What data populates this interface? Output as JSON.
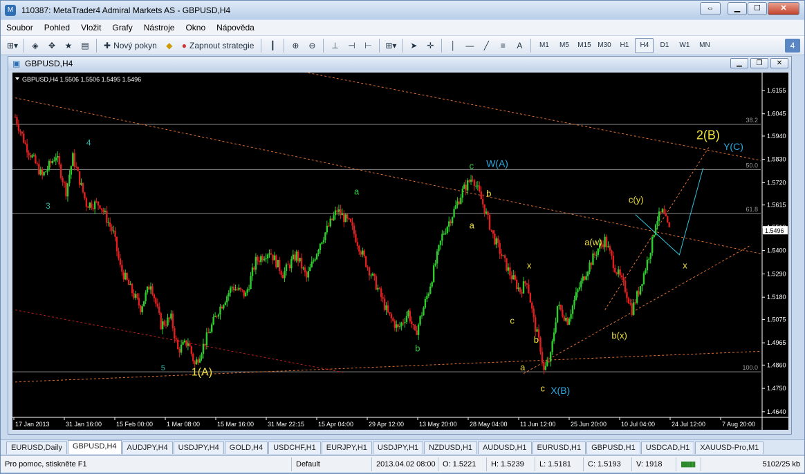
{
  "window": {
    "title": "110387: MetaTrader4 Admiral Markets AS - GBPUSD,H4"
  },
  "menu": [
    "Soubor",
    "Pohled",
    "Vložit",
    "Grafy",
    "Nástroje",
    "Okno",
    "Nápověda"
  ],
  "toolbar": {
    "new_order_label": "Nový pokyn",
    "expert_label": "Zapnout strategie",
    "text_tool_label": "A",
    "timeframes": [
      "M1",
      "M5",
      "M15",
      "M30",
      "H1",
      "H4",
      "D1",
      "W1",
      "MN"
    ],
    "active_timeframe": "H4",
    "badge": "4"
  },
  "chart_window": {
    "title": "GBPUSD,H4"
  },
  "chart_data": {
    "type": "candlestick",
    "symbol_info": "GBPUSD,H4  1.5506 1.5506 1.5495 1.5496",
    "ylim": [
      1.462,
      1.622
    ],
    "y_ticks": [
      "1.6155",
      "1.6045",
      "1.5940",
      "1.5830",
      "1.5720",
      "1.5615",
      "1.5510",
      "1.5400",
      "1.5290",
      "1.5180",
      "1.5075",
      "1.4965",
      "1.4860",
      "1.4750",
      "1.4640"
    ],
    "x_labels": [
      "17 Jan 2013",
      "31 Jan 16:00",
      "15 Feb 00:00",
      "1 Mar 08:00",
      "15 Mar 16:00",
      "31 Mar 22:15",
      "15 Apr 04:00",
      "29 Apr 12:00",
      "13 May 20:00",
      "28 May 04:00",
      "11 Jun 12:00",
      "25 Jun 20:00",
      "10 Jul 04:00",
      "24 Jul 12:00",
      "7 Aug 20:00"
    ],
    "current_price": "1.5496",
    "fib_levels": [
      {
        "label": "38.2",
        "price": 1.5995
      },
      {
        "label": "50.0",
        "price": 1.5782
      },
      {
        "label": "61.8",
        "price": 1.5575
      },
      {
        "label": "100.0",
        "price": 1.4828
      }
    ],
    "price_path": [
      [
        0,
        1.603
      ],
      [
        3,
        1.59
      ],
      [
        8,
        1.575
      ],
      [
        12,
        1.585
      ],
      [
        15,
        1.568
      ],
      [
        17,
        1.584
      ],
      [
        21,
        1.562
      ],
      [
        25,
        1.562
      ],
      [
        29,
        1.548
      ],
      [
        31,
        1.532
      ],
      [
        34,
        1.522
      ],
      [
        37,
        1.513
      ],
      [
        40,
        1.525
      ],
      [
        43,
        1.505
      ],
      [
        46,
        1.508
      ],
      [
        48,
        1.493
      ],
      [
        51,
        1.497
      ],
      [
        53,
        1.486
      ],
      [
        56,
        1.497
      ],
      [
        60,
        1.512
      ],
      [
        64,
        1.523
      ],
      [
        68,
        1.519
      ],
      [
        71,
        1.535
      ],
      [
        75,
        1.54
      ],
      [
        79,
        1.529
      ],
      [
        83,
        1.538
      ],
      [
        86,
        1.527
      ],
      [
        90,
        1.544
      ],
      [
        95,
        1.559
      ],
      [
        99,
        1.552
      ],
      [
        103,
        1.536
      ],
      [
        107,
        1.522
      ],
      [
        110,
        1.51
      ],
      [
        113,
        1.503
      ],
      [
        116,
        1.511
      ],
      [
        118,
        1.5
      ],
      [
        122,
        1.521
      ],
      [
        126,
        1.547
      ],
      [
        129,
        1.557
      ],
      [
        132,
        1.568
      ],
      [
        135,
        1.575
      ],
      [
        138,
        1.562
      ],
      [
        141,
        1.547
      ],
      [
        144,
        1.536
      ],
      [
        146,
        1.529
      ],
      [
        149,
        1.521
      ],
      [
        151,
        1.526
      ],
      [
        153,
        1.507
      ],
      [
        155,
        1.494
      ],
      [
        156,
        1.483
      ],
      [
        158,
        1.49
      ],
      [
        160,
        1.514
      ],
      [
        163,
        1.507
      ],
      [
        166,
        1.521
      ],
      [
        169,
        1.532
      ],
      [
        172,
        1.541
      ],
      [
        174,
        1.545
      ],
      [
        177,
        1.532
      ],
      [
        180,
        1.522
      ],
      [
        182,
        1.512
      ],
      [
        184,
        1.521
      ],
      [
        186,
        1.532
      ],
      [
        188,
        1.544
      ],
      [
        189,
        1.554
      ],
      [
        191,
        1.558
      ],
      [
        193,
        1.5496
      ]
    ],
    "x_max": 220,
    "wave_labels": [
      {
        "text": "4",
        "t": 21,
        "p": 1.5895,
        "color": "#2bb5a5",
        "size": 12
      },
      {
        "text": "3",
        "t": 9,
        "p": 1.5598,
        "color": "#2bb5a5",
        "size": 12
      },
      {
        "text": "5",
        "t": 43,
        "p": 1.4835,
        "color": "#2bb5a5",
        "size": 11
      },
      {
        "text": "1(A)",
        "t": 52,
        "p": 1.481,
        "color": "#f0e040",
        "size": 16
      },
      {
        "text": "a",
        "t": 100,
        "p": 1.5665,
        "color": "#2ecc40",
        "size": 13
      },
      {
        "text": "b",
        "t": 118,
        "p": 1.4925,
        "color": "#2ecc40",
        "size": 13
      },
      {
        "text": "c",
        "t": 134,
        "p": 1.5785,
        "color": "#2ecc40",
        "size": 13
      },
      {
        "text": "W(A)",
        "t": 139,
        "p": 1.5795,
        "color": "#2aa9e0",
        "size": 14
      },
      {
        "text": "b",
        "t": 139,
        "p": 1.5655,
        "color": "#f0e040",
        "size": 13
      },
      {
        "text": "a",
        "t": 134,
        "p": 1.5505,
        "color": "#f0e040",
        "size": 13
      },
      {
        "text": "x",
        "t": 151,
        "p": 1.5315,
        "color": "#f0e040",
        "size": 13
      },
      {
        "text": "c",
        "t": 146,
        "p": 1.5055,
        "color": "#f0e040",
        "size": 13
      },
      {
        "text": "b",
        "t": 153,
        "p": 1.4965,
        "color": "#f0e040",
        "size": 13
      },
      {
        "text": "a",
        "t": 149,
        "p": 1.4835,
        "color": "#f0e040",
        "size": 13
      },
      {
        "text": "c",
        "t": 155,
        "p": 1.4735,
        "color": "#f0e040",
        "size": 13
      },
      {
        "text": "X(B)",
        "t": 158,
        "p": 1.4725,
        "color": "#2aa9e0",
        "size": 14
      },
      {
        "text": "a(w)",
        "t": 168,
        "p": 1.5425,
        "color": "#f0e040",
        "size": 13
      },
      {
        "text": "b(x)",
        "t": 176,
        "p": 1.4985,
        "color": "#f0e040",
        "size": 13
      },
      {
        "text": "c(y)",
        "t": 181,
        "p": 1.5625,
        "color": "#f0e040",
        "size": 13
      },
      {
        "text": "x",
        "t": 197,
        "p": 1.5315,
        "color": "#f0e040",
        "size": 13
      },
      {
        "text": "2(B)",
        "t": 201,
        "p": 1.5925,
        "color": "#f0e040",
        "size": 18
      },
      {
        "text": "Y(C)",
        "t": 209,
        "p": 1.5875,
        "color": "#2aa9e0",
        "size": 14
      }
    ],
    "trend_lines": [
      {
        "from": [
          60,
          1.632
        ],
        "to": [
          220,
          1.5825
        ],
        "color": "#e07030",
        "dash": "3,3"
      },
      {
        "from": [
          0,
          1.612
        ],
        "to": [
          220,
          1.5385
        ],
        "color": "#e07030",
        "dash": "3,3"
      },
      {
        "from": [
          150,
          1.482
        ],
        "to": [
          217,
          1.5425
        ],
        "color": "#e07030",
        "dash": "3,3"
      },
      {
        "from": [
          174,
          1.512
        ],
        "to": [
          205,
          1.5895
        ],
        "color": "#e07030",
        "dash": "3,3"
      },
      {
        "from": [
          0,
          1.478
        ],
        "to": [
          220,
          1.4925
        ],
        "color": "#e07030",
        "dash": "3,3"
      },
      {
        "from": [
          0,
          1.512
        ],
        "to": [
          97,
          1.4825
        ],
        "color": "#c02020",
        "dash": "3,3"
      }
    ],
    "projection": [
      [
        183,
        1.557
      ],
      [
        196,
        1.538
      ],
      [
        203,
        1.579
      ]
    ]
  },
  "tabs": [
    "EURUSD,Daily",
    "GBPUSD,H4",
    "AUDJPY,H4",
    "USDJPY,H4",
    "GOLD,H4",
    "USDCHF,H1",
    "EURJPY,H1",
    "USDJPY,H1",
    "NZDUSD,H1",
    "AUDUSD,H1",
    "EURUSD,H1",
    "GBPUSD,H1",
    "USDCAD,H1",
    "XAUUSD-Pro,M1"
  ],
  "active_tab": "GBPUSD,H4",
  "status": {
    "help": "Pro pomoc, stiskněte F1",
    "profile": "Default",
    "datetime": "2013.04.02 08:00",
    "open": "O: 1.5221",
    "high": "H: 1.5239",
    "low": "L: 1.5181",
    "close": "C: 1.5193",
    "volume": "V: 1918",
    "traffic": "5102/25 kb"
  }
}
